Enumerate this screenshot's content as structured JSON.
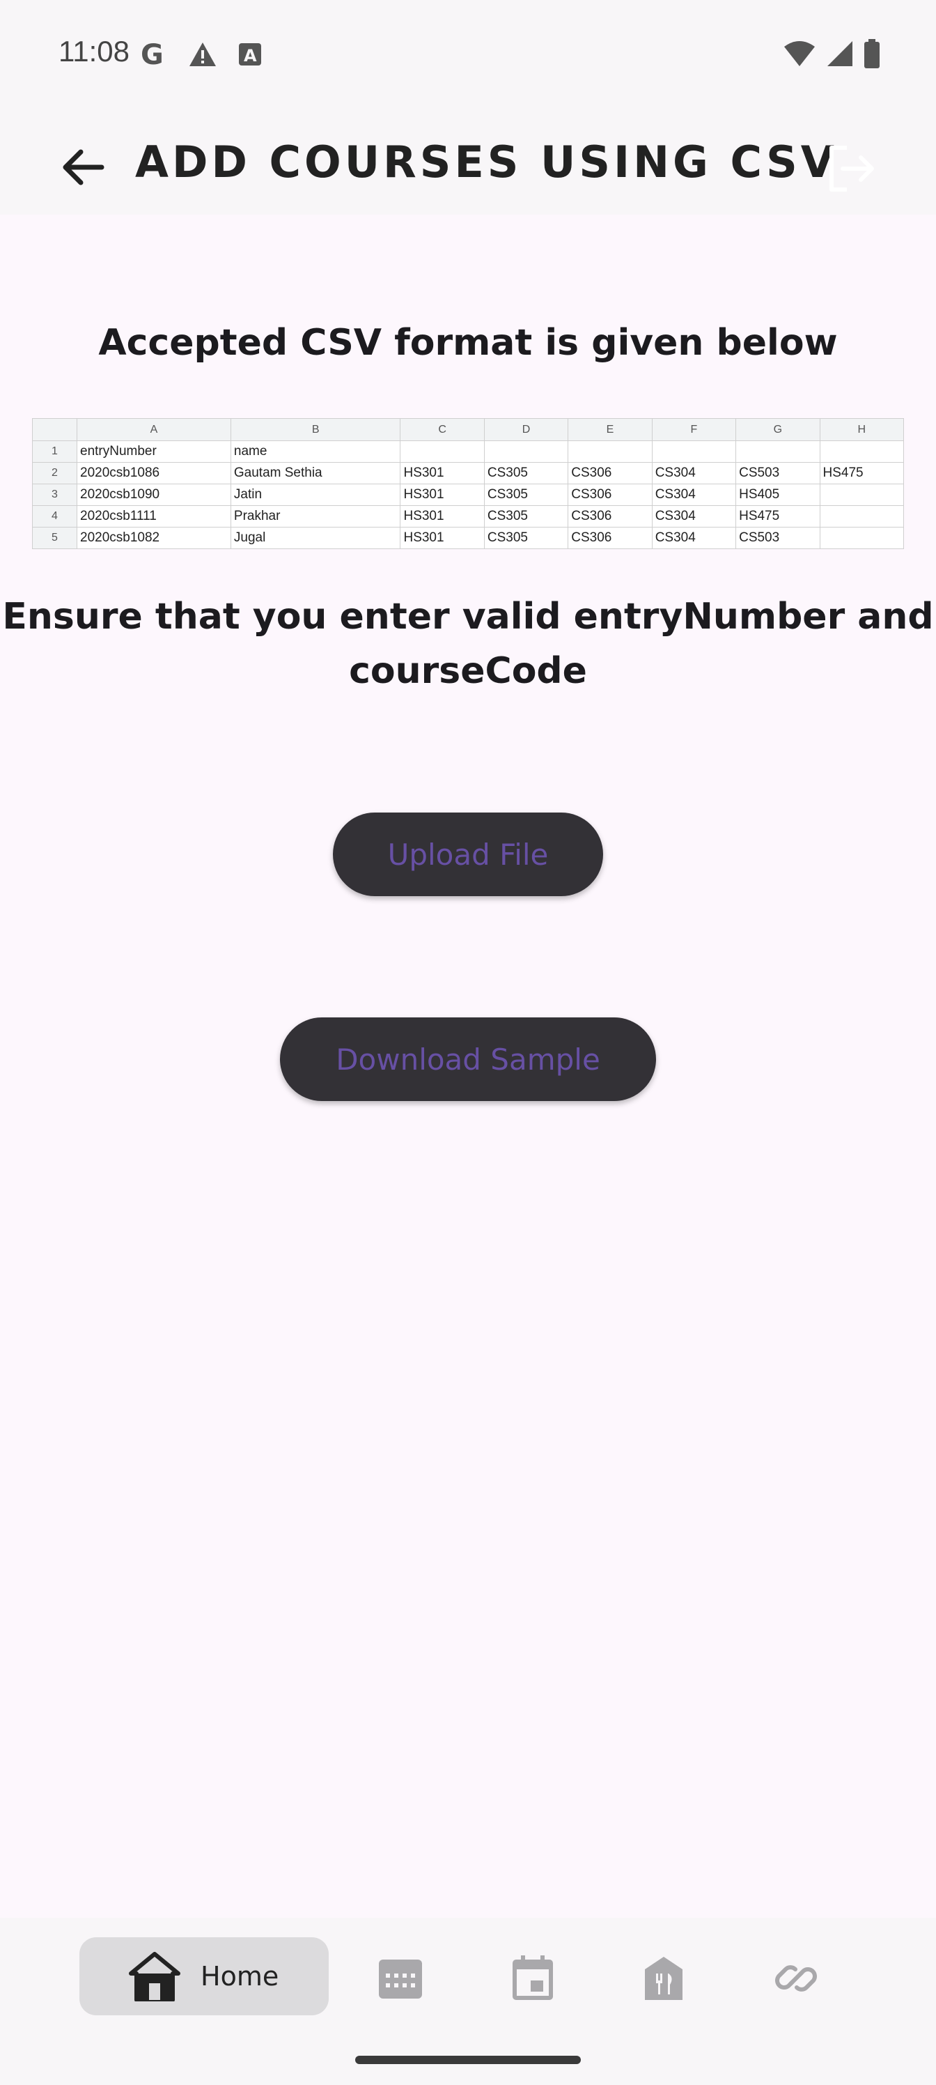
{
  "status_bar": {
    "time": "11:08",
    "left_icons": [
      "google-icon",
      "warning-icon",
      "text-a-icon"
    ],
    "right_icons": [
      "wifi-icon",
      "cellular-signal-icon",
      "battery-icon"
    ]
  },
  "app_bar": {
    "title": "ADD COURSES USING CSV",
    "back_icon": "arrow-back-icon",
    "logout_icon": "logout-icon"
  },
  "content": {
    "heading": "Accepted CSV format is given below",
    "instruction": "Ensure that you enter valid entryNumber and courseCode",
    "upload_button": "Upload File",
    "download_button": "Download Sample"
  },
  "csv_sample": {
    "columns": [
      "A",
      "B",
      "C",
      "D",
      "E",
      "F",
      "G",
      "H"
    ],
    "rows": [
      {
        "num": "1",
        "cells": [
          "entryNumber",
          "name",
          "",
          "",
          "",
          "",
          "",
          ""
        ]
      },
      {
        "num": "2",
        "cells": [
          "2020csb1086",
          "Gautam Sethia",
          "HS301",
          "CS305",
          "CS306",
          "CS304",
          "CS503",
          "HS475"
        ]
      },
      {
        "num": "3",
        "cells": [
          "2020csb1090",
          "Jatin",
          "HS301",
          "CS305",
          "CS306",
          "CS304",
          "HS405",
          ""
        ]
      },
      {
        "num": "4",
        "cells": [
          "2020csb1111",
          "Prakhar",
          "HS301",
          "CS305",
          "CS306",
          "CS304",
          "HS475",
          ""
        ]
      },
      {
        "num": "5",
        "cells": [
          "2020csb1082",
          "Jugal",
          "HS301",
          "CS305",
          "CS306",
          "CS304",
          "CS503",
          ""
        ]
      }
    ]
  },
  "bottom_nav": {
    "items": [
      {
        "label": "Home",
        "icon": "home-icon",
        "selected": true
      },
      {
        "label": "",
        "icon": "calendar-grid-icon",
        "selected": false
      },
      {
        "label": "",
        "icon": "event-icon",
        "selected": false
      },
      {
        "label": "",
        "icon": "restaurant-icon",
        "selected": false
      },
      {
        "label": "",
        "icon": "link-icon",
        "selected": false
      }
    ]
  },
  "colors": {
    "background": "#fdf7fd",
    "button_bg": "#333136",
    "button_text": "#6750a4"
  }
}
